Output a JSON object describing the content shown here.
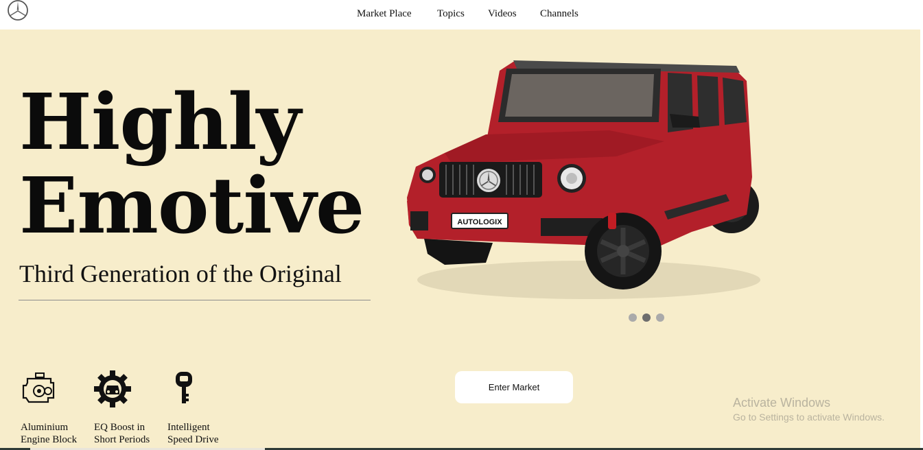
{
  "header": {
    "logo_icon": "mercedes-star-icon",
    "nav": [
      "Market Place",
      "Topics",
      "Videos",
      "Channels"
    ]
  },
  "hero": {
    "headline_line1": "Highly",
    "headline_line2": "Emotive",
    "subtitle": "Third Generation of the Original",
    "car_image": "red-suv-image",
    "plate_text": "AUTOLOGIX",
    "carousel": {
      "count": 3,
      "active_index": 1
    }
  },
  "features": [
    {
      "icon": "engine-icon",
      "label_line1": "Aluminium",
      "label_line2": "Engine Block"
    },
    {
      "icon": "gear-car-icon",
      "label_line1": "EQ Boost in",
      "label_line2": "Short Periods"
    },
    {
      "icon": "car-key-icon",
      "label_line1": "Intelligent",
      "label_line2": "Speed Drive"
    }
  ],
  "cta": {
    "label": "Enter Market"
  },
  "watermark": {
    "line1": "Activate Windows",
    "line2": "Go to Settings to activate Windows."
  },
  "colors": {
    "background": "#f7edcb",
    "header_bg": "#ffffff",
    "car_red": "#b3202a",
    "text": "#0b0b0b"
  }
}
